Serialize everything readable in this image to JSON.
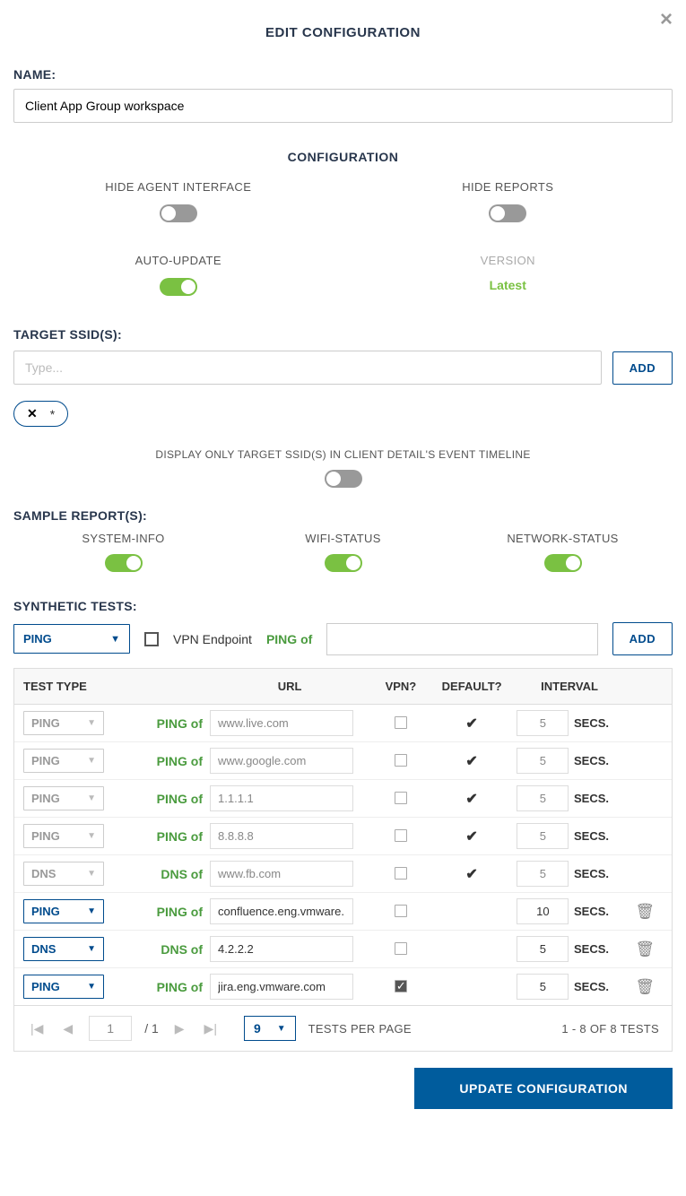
{
  "header": {
    "title": "EDIT CONFIGURATION"
  },
  "name": {
    "label": "NAME:",
    "value": "Client App Group workspace"
  },
  "config": {
    "heading": "CONFIGURATION",
    "hide_agent": {
      "label": "HIDE AGENT INTERFACE",
      "on": false
    },
    "hide_reports": {
      "label": "HIDE REPORTS",
      "on": false
    },
    "auto_update": {
      "label": "AUTO-UPDATE",
      "on": true
    },
    "version": {
      "label": "VERSION",
      "value": "Latest"
    }
  },
  "ssid": {
    "label": "TARGET SSID(S):",
    "placeholder": "Type...",
    "add_btn": "ADD",
    "chip": "*",
    "display_label": "DISPLAY ONLY TARGET SSID(S) IN CLIENT DETAIL'S EVENT TIMELINE",
    "display_on": false
  },
  "sample": {
    "label": "SAMPLE REPORT(S):",
    "items": [
      {
        "label": "SYSTEM-INFO",
        "on": true
      },
      {
        "label": "WIFI-STATUS",
        "on": true
      },
      {
        "label": "NETWORK-STATUS",
        "on": true
      }
    ]
  },
  "synth": {
    "label": "SYNTHETIC TESTS:",
    "type_select": "PING",
    "vpn_cb_label": "VPN Endpoint",
    "ping_of": "PING of",
    "add_btn": "ADD",
    "headers": {
      "type": "TEST TYPE",
      "url": "URL",
      "vpn": "VPN?",
      "def": "DEFAULT?",
      "int": "INTERVAL"
    },
    "unit": "SECS.",
    "rows": [
      {
        "type": "PING",
        "of": "PING of",
        "url": "www.live.com",
        "vpn": false,
        "def": true,
        "interval": "5",
        "editable": false,
        "deletable": false
      },
      {
        "type": "PING",
        "of": "PING of",
        "url": "www.google.com",
        "vpn": false,
        "def": true,
        "interval": "5",
        "editable": false,
        "deletable": false
      },
      {
        "type": "PING",
        "of": "PING of",
        "url": "1.1.1.1",
        "vpn": false,
        "def": true,
        "interval": "5",
        "editable": false,
        "deletable": false
      },
      {
        "type": "PING",
        "of": "PING of",
        "url": "8.8.8.8",
        "vpn": false,
        "def": true,
        "interval": "5",
        "editable": false,
        "deletable": false
      },
      {
        "type": "DNS",
        "of": "DNS of",
        "url": "www.fb.com",
        "vpn": false,
        "def": true,
        "interval": "5",
        "editable": false,
        "deletable": false
      },
      {
        "type": "PING",
        "of": "PING of",
        "url": "confluence.eng.vmware.",
        "vpn": false,
        "def": false,
        "interval": "10",
        "editable": true,
        "deletable": true
      },
      {
        "type": "DNS",
        "of": "DNS of",
        "url": "4.2.2.2",
        "vpn": false,
        "def": false,
        "interval": "5",
        "editable": true,
        "deletable": true
      },
      {
        "type": "PING",
        "of": "PING of",
        "url": "jira.eng.vmware.com",
        "vpn": true,
        "def": false,
        "interval": "5",
        "editable": true,
        "deletable": true
      }
    ]
  },
  "pager": {
    "page": "1",
    "total": "/ 1",
    "perpage": "9",
    "perpage_label": "TESTS PER PAGE",
    "count": "1 - 8 OF 8 TESTS"
  },
  "footer": {
    "update_btn": "UPDATE CONFIGURATION"
  }
}
